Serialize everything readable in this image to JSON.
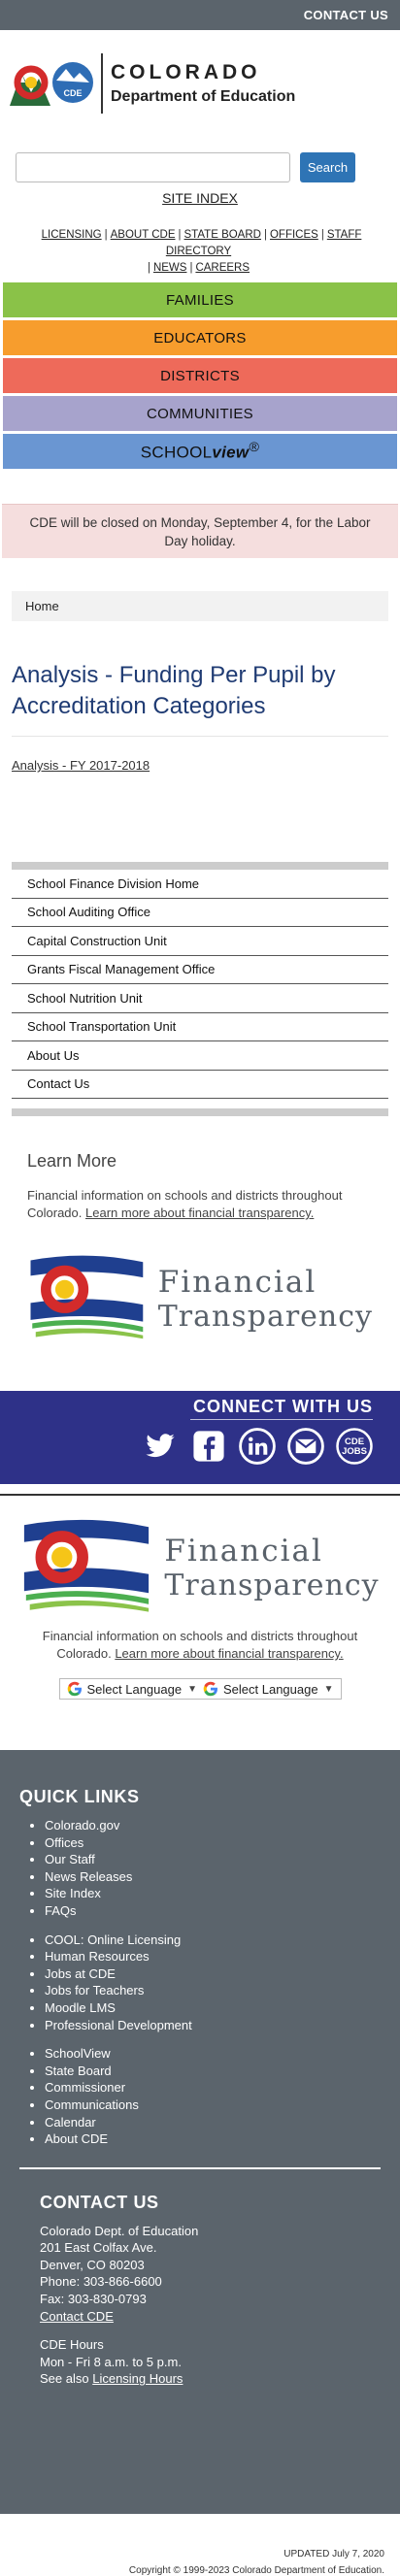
{
  "topbar": {
    "contact": "CONTACT US"
  },
  "logo": {
    "line1": "COLORADO",
    "line2": "Department of Education",
    "badge": "CDE"
  },
  "search": {
    "placeholder": "",
    "button": "Search",
    "site_index": "SITE INDEX"
  },
  "utility_links": [
    "LICENSING",
    "ABOUT CDE",
    "STATE BOARD",
    "OFFICES",
    "STAFF DIRECTORY",
    "NEWS",
    "CAREERS"
  ],
  "nav_bands": {
    "families": "FAMILIES",
    "educators": "EDUCATORS",
    "districts": "DISTRICTS",
    "communities": "COMMUNITIES",
    "schoolview_a": "SCHOOL",
    "schoolview_b": "view",
    "schoolview_tm": "®"
  },
  "alert": "CDE will be closed on Monday, September 4, for the Labor Day holiday.",
  "breadcrumb": "Home",
  "page": {
    "title": "Analysis - Funding Per Pupil by Accreditation Categories",
    "link": "Analysis - FY 2017-2018"
  },
  "side_nav": [
    "School Finance Division Home",
    "School Auditing Office",
    "Capital Construction Unit",
    "Grants Fiscal Management Office",
    "School Nutrition Unit",
    "School Transportation Unit",
    "About Us",
    "Contact Us"
  ],
  "learn_more": {
    "heading": "Learn More",
    "text": "Financial information on schools and districts throughout Colorado.",
    "link": "Learn more about financial transparency."
  },
  "financial_transparency": {
    "word1": "Financial",
    "word2": "Transparency"
  },
  "connect": {
    "title": "CONNECT WITH US",
    "social": [
      "twitter-icon",
      "facebook-icon",
      "linkedin-icon",
      "email-icon",
      "cde-jobs-icon"
    ],
    "jobs_line1": "CDE",
    "jobs_line2": "JOBS"
  },
  "footer_text": {
    "text": "Financial information on schools and districts throughout Colorado.",
    "link": "Learn more about financial transparency."
  },
  "translate": {
    "label": "Select Language"
  },
  "quick_links": {
    "title": "QUICK LINKS",
    "group1": [
      "Colorado.gov",
      "Offices",
      "Our Staff",
      "News Releases",
      "Site Index",
      "FAQs"
    ],
    "group2": [
      "COOL: Online Licensing",
      "Human Resources",
      "Jobs at CDE",
      "Jobs for Teachers",
      "Moodle LMS",
      "Professional Development"
    ],
    "group3": [
      "SchoolView",
      "State Board",
      "Commissioner",
      "Communications",
      "Calendar",
      "About CDE"
    ]
  },
  "contact": {
    "title": "CONTACT US",
    "lines": [
      "Colorado Dept. of Education",
      "201 East Colfax Ave.",
      "Denver, CO 80203",
      "Phone: 303-866-6600",
      "Fax: 303-830-0793"
    ],
    "contact_link": "Contact CDE",
    "hours_title": "CDE Hours",
    "hours": "Mon - Fri 8 a.m. to 5 p.m.",
    "see_also": "See also",
    "licensing_hours": "Licensing Hours"
  },
  "updated": "UPDATED July 7, 2020",
  "copyright": "Copyright © 1999-2023 Colorado Department of Education.",
  "colors": {
    "topbar": "#5b646c",
    "families": "#8ac248",
    "educators": "#f79d2d",
    "districts": "#ee6a5a",
    "communities": "#a7a3cc",
    "schoolview": "#6a96d2",
    "title": "#1f3b73",
    "connect": "#2e3188",
    "search": "#2e74b5"
  }
}
